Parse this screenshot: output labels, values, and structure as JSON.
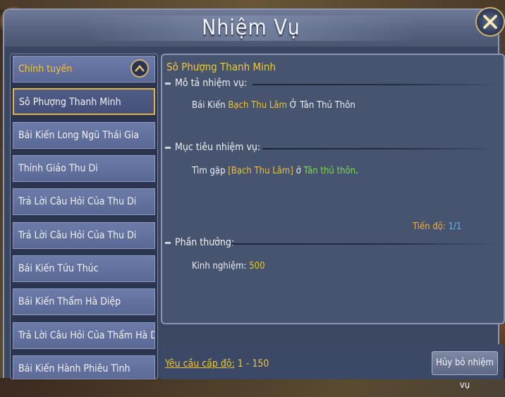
{
  "window": {
    "title": "Nhiệm Vụ"
  },
  "sidebar": {
    "category": "Chính tuyến",
    "items": [
      {
        "label": "Sô Phượng Thanh Minh",
        "active": true
      },
      {
        "label": "Bái Kiến Long Ngũ Thái Gia"
      },
      {
        "label": "Thỉnh Giáo Thu Di"
      },
      {
        "label": "Trả Lời Câu Hỏi Của Thu Di"
      },
      {
        "label": "Trả Lời Câu Hỏi Của Thu Di"
      },
      {
        "label": "Bái Kiến Tứu Thúc"
      },
      {
        "label": "Bái Kiến Thẩm Hà Diệp"
      },
      {
        "label": "Trả Lời Câu Hỏi Của Thẩm Hà Diệp"
      },
      {
        "label": "Bái Kiến Hành Phiêu Tình"
      }
    ]
  },
  "detail": {
    "title": "Sô Phượng Thanh Minh",
    "description_heading": "Mô tả nhiệm vụ:",
    "description": {
      "prefix": "Bái Kiến ",
      "npc": "Bạch Thu Lâm",
      "suffix": " Ở Tân Thủ Thôn"
    },
    "objective_heading": "Mục tiêu nhiệm vụ:",
    "objective": {
      "prefix": "Tìm gặp ",
      "npc": "[Bạch Thu Lâm]",
      "middle": " ở ",
      "place": "Tân thủ thôn",
      "end": "."
    },
    "progress_label": "Tiến độ: ",
    "progress_value": "1/1",
    "reward_heading": "Phần thưởng:",
    "reward_label": "Kinh nghiệm: ",
    "reward_value": "500"
  },
  "footer": {
    "level_label": "Yêu cầu cấp độ:",
    "level_value": " 1 - 150",
    "cancel_button": "Hủy bỏ nhiệm vụ"
  },
  "colors": {
    "accent": "#f3c733",
    "panel": "#46546f",
    "highlight_green": "#7fdc4a",
    "progress_blue": "#5ab8f0"
  }
}
